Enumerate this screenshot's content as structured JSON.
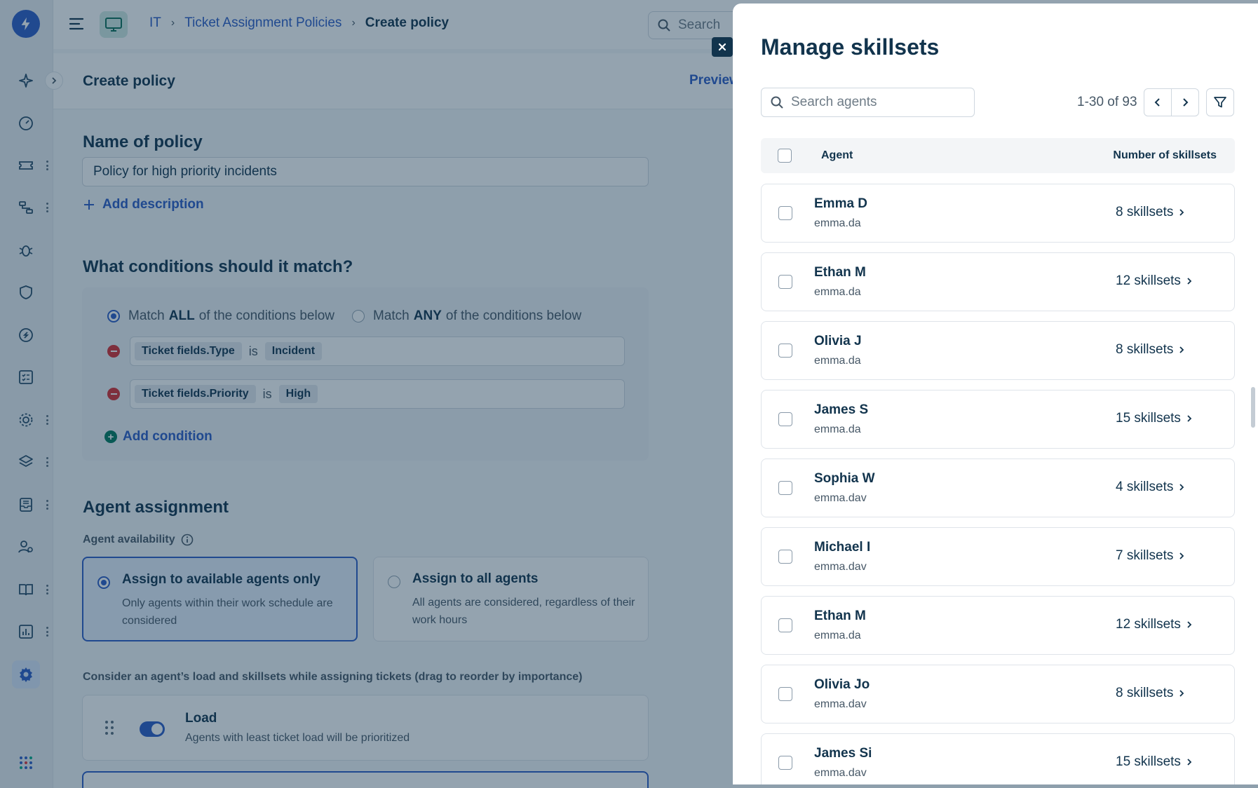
{
  "topbar": {
    "breadcrumbs": [
      "IT",
      "Ticket Assignment Policies",
      "Create policy"
    ],
    "search_placeholder": "Search"
  },
  "subbar": {
    "title": "Create policy",
    "preview_label": "Preview"
  },
  "form": {
    "name_heading": "Name of policy",
    "name_value": "Policy for high priority incidents",
    "add_description": "Add description",
    "conditions_heading": "What conditions should it match?",
    "match_all_pre": "Match",
    "match_all_bold": "ALL",
    "match_all_post": "of the conditions below",
    "match_any_pre": "Match",
    "match_any_bold": "ANY",
    "match_any_post": "of the conditions below",
    "conditions": [
      {
        "field": "Ticket fields.Type",
        "operator": "is",
        "value": "Incident"
      },
      {
        "field": "Ticket fields.Priority",
        "operator": "is",
        "value": "High"
      }
    ],
    "add_condition": "Add condition",
    "agent_heading": "Agent assignment",
    "availability_label": "Agent availability",
    "options": [
      {
        "title": "Assign to available agents only",
        "desc": "Only agents within their work schedule are considered",
        "selected": true
      },
      {
        "title": "Assign to all agents",
        "desc": "All agents are considered, regardless of their work hours",
        "selected": false
      }
    ],
    "consider_label": "Consider an agent’s load and skillsets while assigning tickets (drag to reorder by importance)",
    "load_title": "Load",
    "load_desc": "Agents with least ticket load will be prioritized",
    "load_enabled": true
  },
  "drawer": {
    "title": "Manage skillsets",
    "search_placeholder": "Search agents",
    "page_count": "1-30 of 93",
    "col_agent": "Agent",
    "col_count": "Number of skillsets",
    "rows": [
      {
        "name": "Emma D",
        "email": "emma.da",
        "skillsets": "8 skillsets"
      },
      {
        "name": "Ethan M",
        "email": "emma.da",
        "skillsets": "12 skillsets"
      },
      {
        "name": "Olivia J",
        "email": "emma.da",
        "skillsets": "8 skillsets"
      },
      {
        "name": "James S",
        "email": "emma.da",
        "skillsets": "15 skillsets"
      },
      {
        "name": "Sophia W",
        "email": "emma.dav",
        "skillsets": "4 skillsets"
      },
      {
        "name": "Michael I",
        "email": "emma.dav",
        "skillsets": "7 skillsets"
      },
      {
        "name": "Ethan M",
        "email": "emma.da",
        "skillsets": "12 skillsets"
      },
      {
        "name": "Olivia Jo",
        "email": "emma.dav",
        "skillsets": "8 skillsets"
      },
      {
        "name": "James Si",
        "email": "emma.dav",
        "skillsets": "15 skillsets"
      }
    ]
  },
  "icons": {
    "rail": [
      "sparkle-icon",
      "gauge-icon",
      "ticket-icon",
      "workflow-icon",
      "bug-icon",
      "shield-icon",
      "dollar-icon",
      "checklist-icon",
      "cog-group-icon",
      "layers-icon",
      "inbox-icon",
      "people-icon",
      "book-icon",
      "chart-icon",
      "settings-icon",
      "apps-grid-icon"
    ]
  },
  "colors": {
    "brand": "#2c5cc5",
    "overlay": "rgba(18,52,77,0.45)",
    "danger": "#d72d30",
    "success": "#00795b"
  }
}
